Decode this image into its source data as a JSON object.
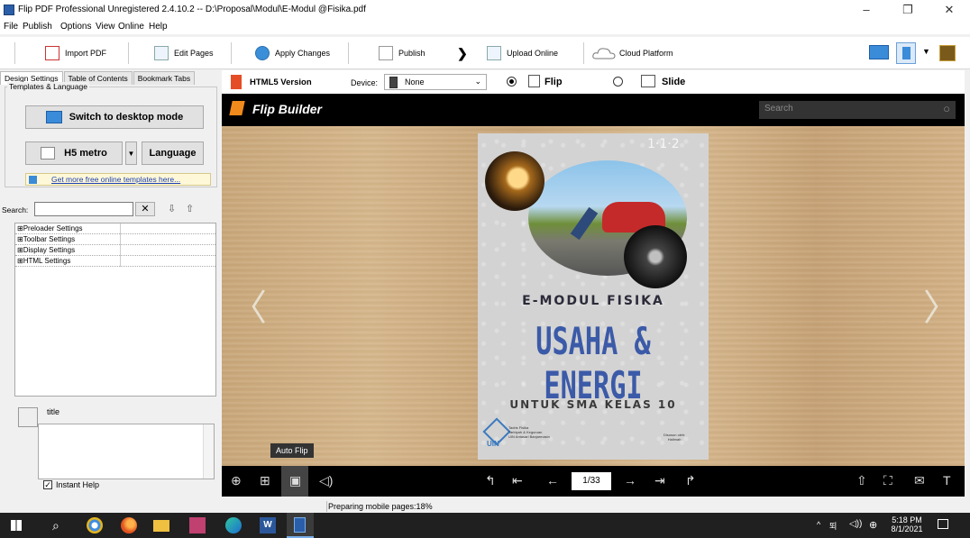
{
  "window": {
    "title": "Flip PDF Professional Unregistered 2.4.10.2 -- D:\\Proposal\\Modul\\E-Modul @Fisika.pdf",
    "minimize": "–",
    "maximize": "❐",
    "close": "✕"
  },
  "menu": [
    "File",
    "Publish",
    "Options",
    "View",
    "Online",
    "Help"
  ],
  "toolbar": {
    "import": "Import PDF",
    "edit": "Edit Pages",
    "apply": "Apply Changes",
    "publish": "Publish",
    "upload": "Upload Online",
    "cloud": "Cloud Platform"
  },
  "left": {
    "tabs": [
      "Design Settings",
      "Table of Contents",
      "Bookmark Tabs"
    ],
    "group_label": "Templates & Language",
    "switch_desktop": "Switch to desktop mode",
    "h5_metro": "H5 metro",
    "language": "Language",
    "templates_link": "Get more free online templates here...",
    "search_label": "Search:",
    "settings_rows": [
      "⊞Preloader Settings",
      "⊞Toolbar Settings",
      "⊞Display Settings",
      "⊞HTML Settings"
    ],
    "help_title": "title",
    "instant_help": "Instant Help"
  },
  "htmlbar": {
    "version": "HTML5 Version",
    "device_label": "Device:",
    "device_value": "None",
    "flip": "Flip",
    "slide": "Slide"
  },
  "preview": {
    "brand": "Flip Builder",
    "search_placeholder": "Search",
    "tooltip": "Auto Flip",
    "page_indicator": "1/33"
  },
  "cover": {
    "number_badge": "1·1·2",
    "subtitle": "E-MODUL FISIKA",
    "title": "USAHA & ENERGI",
    "grade": "UNTUK SMA KELAS 10",
    "logo_text": "UIN",
    "org_line1": "Tadris Fisika",
    "org_line2": "Tarbiyah & Keguruan",
    "org_line3": "UIN Antasari Banjarmasin",
    "author_label": "Disusun oleh:",
    "author_name": "Halimah"
  },
  "status": "Preparing mobile pages:18%",
  "taskbar": {
    "time": "5:18 PM",
    "date": "8/1/2021"
  }
}
